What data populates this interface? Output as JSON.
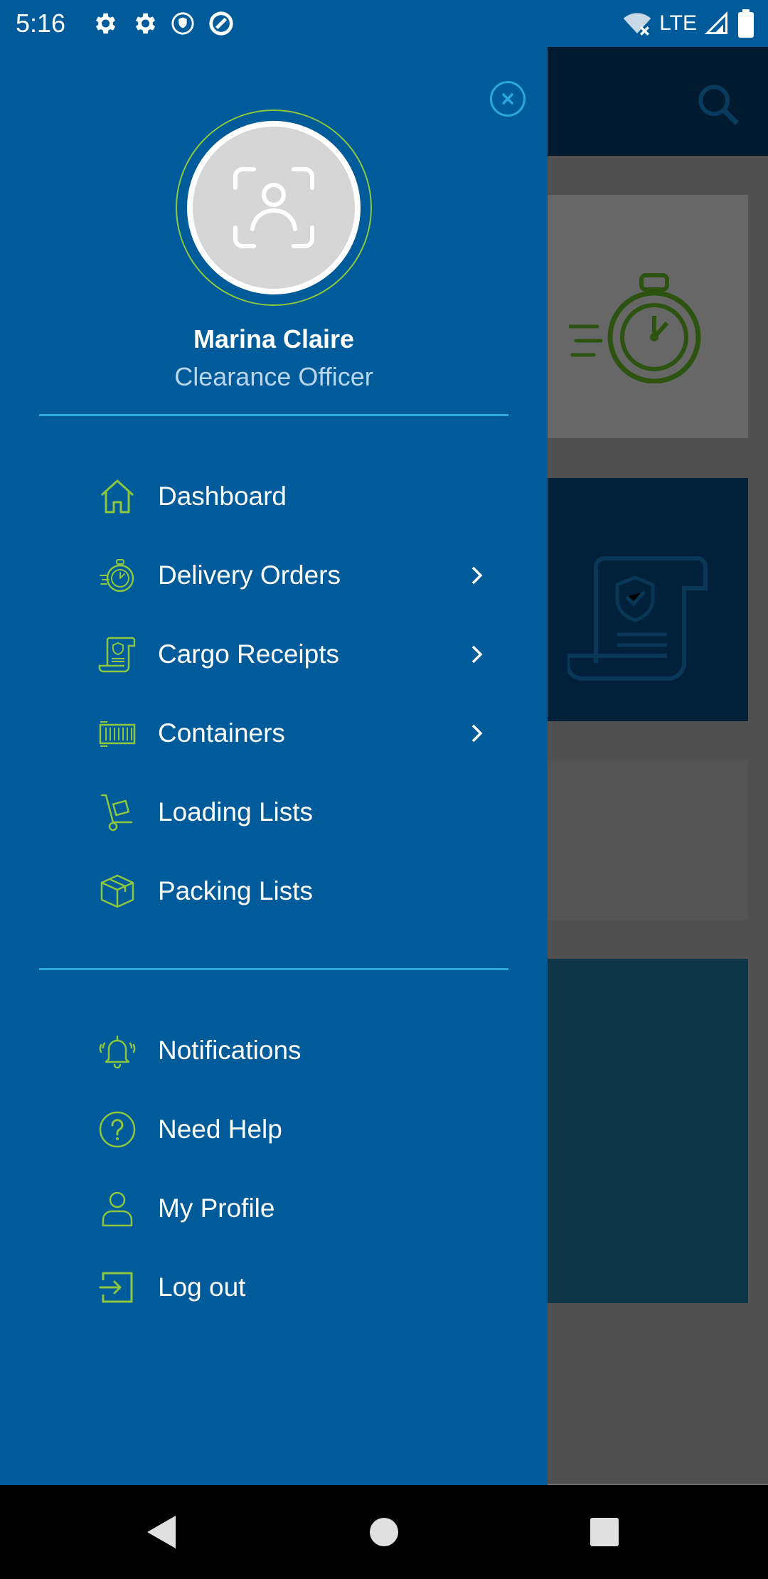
{
  "status_bar": {
    "time": "5:16",
    "network": "LTE",
    "icons_left": [
      "gear-icon",
      "gear-icon",
      "shield-icon",
      "vpn-icon"
    ],
    "icons_right": [
      "wifi-off-icon",
      "signal-icon",
      "battery-icon"
    ]
  },
  "drawer": {
    "user": {
      "name": "Marina Claire",
      "role": "Clearance Officer"
    },
    "primary_items": [
      {
        "label": "Dashboard",
        "icon": "home-icon",
        "has_submenu": false
      },
      {
        "label": "Delivery Orders",
        "icon": "stopwatch-icon",
        "has_submenu": true
      },
      {
        "label": "Cargo Receipts",
        "icon": "receipt-icon",
        "has_submenu": true
      },
      {
        "label": "Containers",
        "icon": "container-icon",
        "has_submenu": true
      },
      {
        "label": "Loading Lists",
        "icon": "hand-truck-icon",
        "has_submenu": false
      },
      {
        "label": "Packing Lists",
        "icon": "box-icon",
        "has_submenu": false
      }
    ],
    "secondary_items": [
      {
        "label": "Notifications",
        "icon": "bell-icon"
      },
      {
        "label": "Need Help",
        "icon": "help-icon"
      },
      {
        "label": "My Profile",
        "icon": "user-icon"
      },
      {
        "label": "Log out",
        "icon": "logout-icon"
      }
    ]
  },
  "colors": {
    "drawer_bg": "#005b9a",
    "accent_green": "#8dc63f",
    "accent_blue": "#2aa7df",
    "topbar_dark": "#00243f"
  },
  "nav_bar": {
    "buttons": [
      "back-icon",
      "home-circle-icon",
      "recents-icon"
    ]
  }
}
